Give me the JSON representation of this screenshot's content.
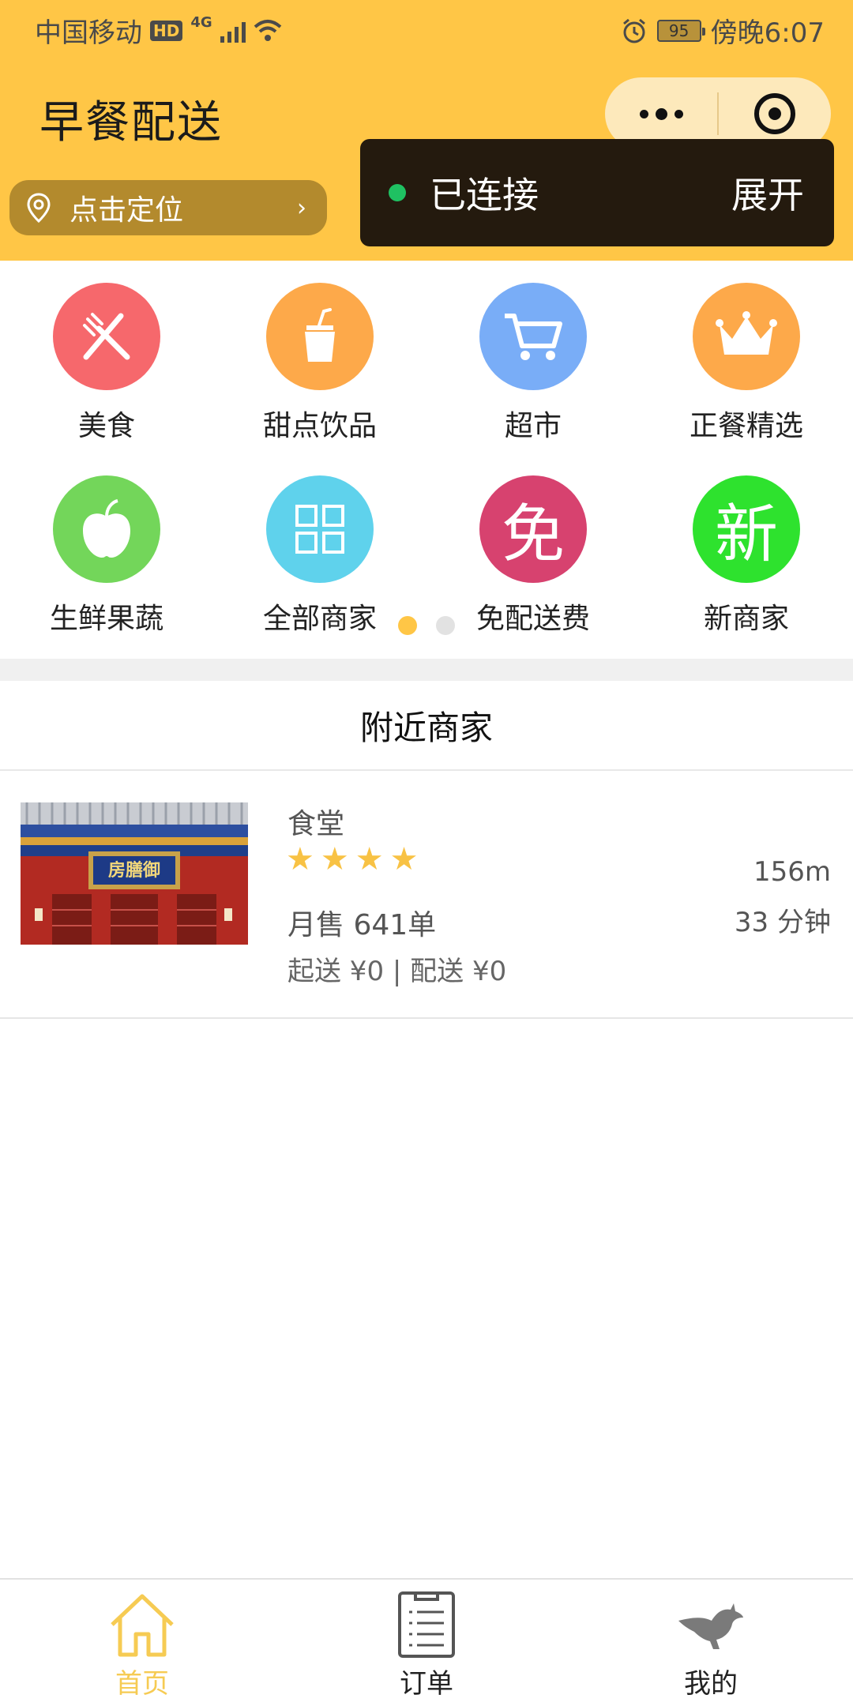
{
  "status_bar": {
    "carrier": "中国移动",
    "hd": "HD",
    "network": "4G",
    "battery": "95",
    "time": "傍晚6:07"
  },
  "header": {
    "title": "早餐配送",
    "location_label": "点击定位",
    "location_arrow": "›"
  },
  "toast": {
    "status": "已连接",
    "expand_label": "展开"
  },
  "categories": [
    {
      "label": "美食",
      "icon": "fork-knife-icon",
      "color": "#F6686C"
    },
    {
      "label": "甜点饮品",
      "icon": "drink-cup-icon",
      "color": "#FDA94A"
    },
    {
      "label": "超市",
      "icon": "shopping-cart-icon",
      "color": "#79ADF7"
    },
    {
      "label": "正餐精选",
      "icon": "crown-icon",
      "color": "#FDA94A"
    },
    {
      "label": "生鲜果蔬",
      "icon": "apple-icon",
      "color": "#73D65A"
    },
    {
      "label": "全部商家",
      "icon": "grid-icon",
      "color": "#5FD2EC"
    },
    {
      "label": "免配送费",
      "icon_text": "免",
      "icon": "free-badge-icon",
      "color": "#D7426F"
    },
    {
      "label": "新商家",
      "icon_text": "新",
      "icon": "new-badge-icon",
      "color": "#2EE22E"
    }
  ],
  "pager": {
    "active": 0,
    "count": 2,
    "active_color": "#FFC646",
    "inactive_color": "#E2E2E2"
  },
  "nearby": {
    "title": "附近商家",
    "merchants": [
      {
        "name": "食堂",
        "rating": 4,
        "monthly_sales": "月售 641单",
        "fee_line": "起送 ¥0 | 配送 ¥0",
        "distance": "156m",
        "delivery_time": "33 分钟",
        "photo_plaque": "房膳御"
      }
    ]
  },
  "tabbar": {
    "items": [
      {
        "label": "首页",
        "icon": "home-icon",
        "active": true
      },
      {
        "label": "订单",
        "icon": "order-list-icon",
        "active": false
      },
      {
        "label": "我的",
        "icon": "kangaroo-icon",
        "active": false
      }
    ],
    "active_color": "#F6CB53",
    "inactive_color": "#222222"
  },
  "colors": {
    "brand": "#FFC646",
    "toast_bg": "#241A0E",
    "star": "#F8C244"
  }
}
